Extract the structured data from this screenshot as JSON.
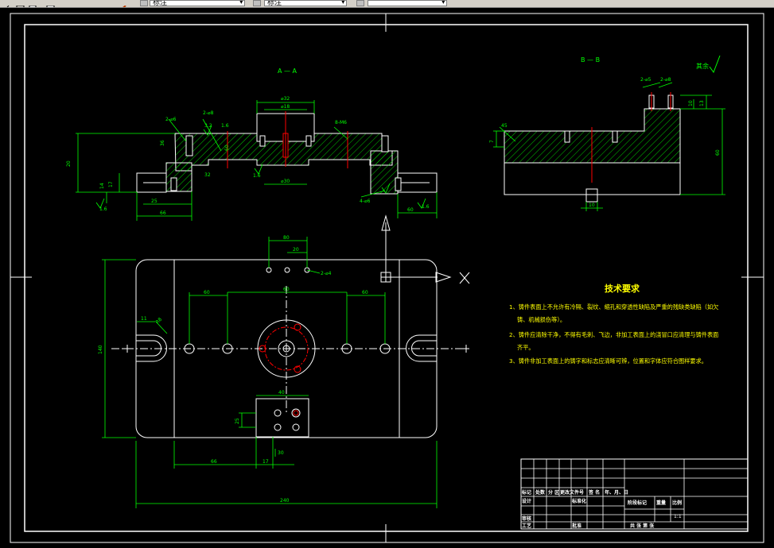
{
  "toolbar": {
    "layer_combo": "标注",
    "style_combo": "标注",
    "third_combo": ""
  },
  "drawing": {
    "section_a_label": "A — A",
    "section_b_label": "B — B",
    "roughness_other": "其余",
    "tech_title": "技术要求",
    "tech_lines": [
      "1、铸件表面上不允许有冷隔、裂纹、缩孔和穿透性缺陷及严重的残缺类缺陷（如欠",
      "铸、机械损伤等）。",
      "2、铸件应清除干净，不得有毛刺、飞边，非加工表面上的浇冒口应清理与铸件表面",
      "齐平。",
      "3、铸件非加工表面上的铸字和标志应清晰可辨，位置和字体应符合图样要求。"
    ],
    "dims_front": [
      "⌀32",
      "⌀18",
      "⌀30",
      "60",
      "36",
      "32",
      "14",
      "17",
      "25",
      "20",
      "66",
      "60",
      "8-M6",
      "2-⌀8",
      "2-⌀6",
      "4-⌀6",
      "1.6",
      "1.6",
      "3.2",
      "1.6",
      "1.6"
    ],
    "dims_side": [
      "2-⌀5",
      "2-⌀8",
      "10",
      "13",
      "60",
      "7",
      "45",
      "10"
    ],
    "dims_plan": [
      "80",
      "20",
      "2-⌀4",
      "60",
      "60",
      "60",
      "11",
      "R8",
      "140",
      "40",
      "25",
      "66",
      "17",
      "30",
      "240"
    ],
    "title_block": {
      "row1": [
        "标记",
        "处数",
        "分 区",
        "更改文件号",
        "签 名",
        "年、月、日"
      ],
      "design": "设计",
      "standardize": "标准化",
      "check": "审核",
      "process": "工艺",
      "approve": "批准",
      "stage_label": "阶段标记",
      "weight_label": "重量",
      "scale_label": "比例",
      "scale_value": "1:1",
      "sheet_label": "共   张   第   张"
    }
  }
}
